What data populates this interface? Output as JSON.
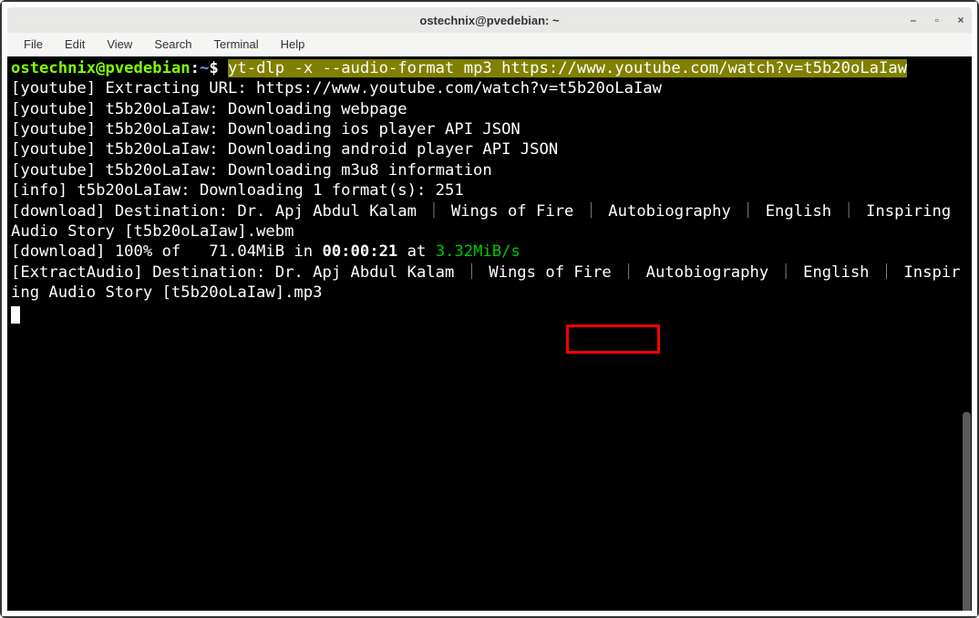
{
  "window": {
    "title": "ostechnix@pvedebian: ~",
    "controls": {
      "min": "–",
      "max": "▫",
      "close": "×"
    }
  },
  "menubar": [
    "File",
    "Edit",
    "View",
    "Search",
    "Terminal",
    "Help"
  ],
  "prompt": {
    "userhost": "ostechnix@pvedebian",
    "sep1": ":",
    "path": "~",
    "sep2": "$ ",
    "command": "yt-dlp -x --audio-format mp3 https://www.youtube.com/watch?v=t5b20oLaIaw"
  },
  "out": {
    "l1": "[youtube] Extracting URL: https://www.youtube.com/watch?v=t5b20oLaIaw",
    "l2": "[youtube] t5b20oLaIaw: Downloading webpage",
    "l3": "[youtube] t5b20oLaIaw: Downloading ios player API JSON",
    "l4": "[youtube] t5b20oLaIaw: Downloading android player API JSON",
    "l5": "[youtube] t5b20oLaIaw: Downloading m3u8 information",
    "l6": "[info] t5b20oLaIaw: Downloading 1 format(s): 251",
    "l7a": "[download] Destination: Dr. Apj Abdul Kalam ",
    "l7b": "｜",
    "l7c": " Wings of Fire ",
    "l7d": "｜",
    "l7e": " Autobiography ",
    "l7f": "｜",
    "l7g": " English ",
    "l7h": "｜",
    "l7i": " Inspiring Audio Story [t5b20oLaIaw].webm",
    "l8a": "[download] 100% of   71.04MiB in ",
    "l8b": "00:00:21",
    "l8c": " at ",
    "l8d": "3.32MiB/s",
    "l9a": "[ExtractAudio] Destination: Dr. Apj Abdul Kalam ",
    "l9b": "｜",
    "l9c": " Wings of Fire ",
    "l9d": "｜",
    "l9e": " Autobiography ",
    "l9f": "｜",
    "l9g": " English ",
    "l9h": "｜",
    "l9i": " Inspiring Audio Story [t5b20oLaIaw].mp3"
  }
}
